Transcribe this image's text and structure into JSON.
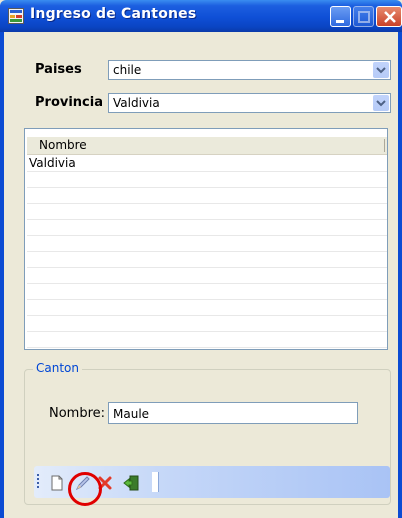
{
  "window": {
    "title": "Ingreso de Cantones",
    "buttons": [
      "minimize",
      "maximize",
      "close"
    ]
  },
  "form": {
    "paises_label": "Paises",
    "paises_value": "chile",
    "provincia_label": "Provincia",
    "provincia_value": "Valdivia"
  },
  "listview": {
    "column_header": "Nombre",
    "rows": [
      "Valdivia"
    ]
  },
  "canton_group": {
    "legend": "Canton",
    "nombre_label": "Nombre:",
    "nombre_value": "Maule"
  },
  "toolbar": {
    "buttons": [
      "new-icon",
      "edit-icon",
      "delete-icon",
      "exit-icon"
    ]
  },
  "colors": {
    "titlebar": "#0f4fd6",
    "group_legend": "#0046d5",
    "annotation": "#e00000",
    "delete": "#e23a2a"
  }
}
